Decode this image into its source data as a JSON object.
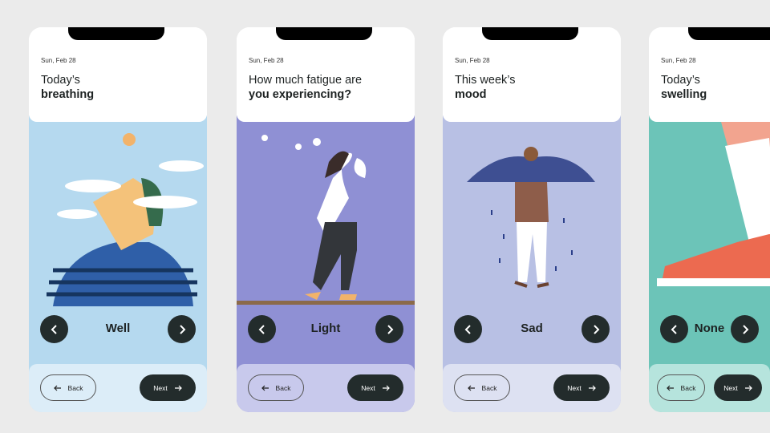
{
  "cards": [
    {
      "date": "Sun, Feb 28",
      "title_line1": "Today’s",
      "title_line2": "breathing",
      "value": "Well",
      "back": "Back",
      "next": "Next",
      "colors": {
        "illustration": "#b5d9ef",
        "footer": "#dcedf8"
      }
    },
    {
      "date": "Sun, Feb 28",
      "title_line1": "How much fatigue are",
      "title_line2": "you experiencing?",
      "value": "Light",
      "back": "Back",
      "next": "Next",
      "colors": {
        "illustration": "#8f90d4",
        "footer": "#c8c9ec"
      }
    },
    {
      "date": "Sun, Feb 28",
      "title_line1": "This week’s",
      "title_line2": "mood",
      "value": "Sad",
      "back": "Back",
      "next": "Next",
      "colors": {
        "illustration": "#b8c0e4",
        "footer": "#dde1f2"
      }
    },
    {
      "date": "Sun, Feb 28",
      "title_line1": "Today’s",
      "title_line2": "swelling",
      "value": "None",
      "back": "Back",
      "next": "Next",
      "colors": {
        "illustration": "#6cc4b8",
        "footer": "#b6e4dd"
      }
    }
  ],
  "icons": {
    "prev": "chevron-left-icon",
    "next": "chevron-right-icon",
    "back": "arrow-left-icon",
    "forward": "arrow-right-icon"
  }
}
